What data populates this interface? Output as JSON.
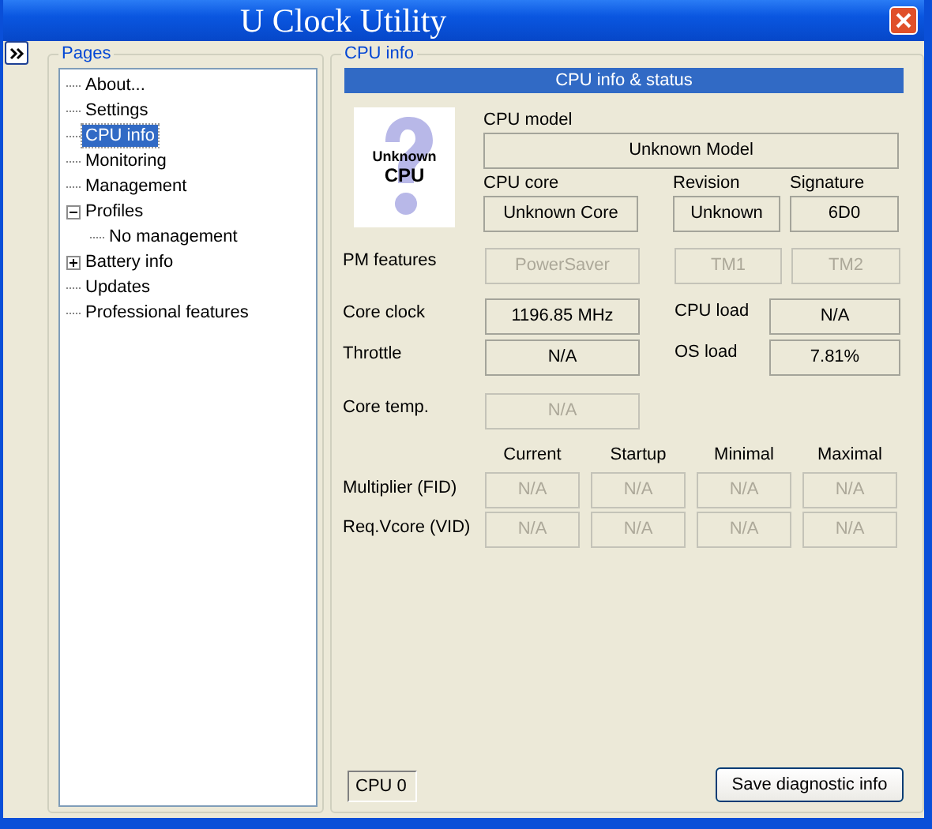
{
  "window": {
    "title": "U Clock Utility"
  },
  "pages": {
    "title": "Pages",
    "items": [
      {
        "label": "About...",
        "selected": false
      },
      {
        "label": "Settings",
        "selected": false
      },
      {
        "label": "CPU info",
        "selected": true
      },
      {
        "label": "Monitoring",
        "selected": false
      },
      {
        "label": "Management",
        "selected": false
      },
      {
        "label": "Profiles",
        "selected": false,
        "expanded": true,
        "children": [
          {
            "label": "No management",
            "selected": false
          }
        ]
      },
      {
        "label": "Battery info",
        "selected": false,
        "expanded": false
      },
      {
        "label": "Updates",
        "selected": false
      },
      {
        "label": "Professional features",
        "selected": false
      }
    ]
  },
  "cpu_info": {
    "title": "CPU info",
    "header": "CPU info & status",
    "image": {
      "line_1": "Unknown",
      "line_2": "CPU"
    },
    "model": {
      "label": "CPU model",
      "value": "Unknown Model"
    },
    "identity": [
      {
        "label": "CPU core",
        "value": "Unknown Core",
        "disabled": false
      },
      {
        "label": "Revision",
        "value": "Unknown",
        "disabled": false
      },
      {
        "label": "Signature",
        "value": "6D0",
        "disabled": false
      }
    ],
    "pm_features": {
      "label": "PM features",
      "values": [
        {
          "value": "PowerSaver",
          "disabled": true
        },
        {
          "value": "TM1",
          "disabled": true
        },
        {
          "value": "TM2",
          "disabled": true
        }
      ]
    },
    "readings": [
      {
        "label": "Core clock",
        "value": "1196.85 MHz",
        "disabled": false,
        "side": {
          "label": "CPU load",
          "value": "N/A",
          "disabled": false
        }
      },
      {
        "label": "Throttle",
        "value": "N/A",
        "disabled": false,
        "side": {
          "label": "OS load",
          "value": "7.81%",
          "disabled": false
        }
      },
      {
        "label": "Core temp.",
        "value": "N/A",
        "disabled": true
      }
    ],
    "ratios": {
      "columns": [
        "Current",
        "Startup",
        "Minimal",
        "Maximal"
      ],
      "rows": [
        {
          "label": "Multiplier (FID)",
          "cells": [
            {
              "value": "N/A",
              "disabled": true
            },
            {
              "value": "N/A",
              "disabled": true
            },
            {
              "value": "N/A",
              "disabled": true
            },
            {
              "value": "N/A",
              "disabled": true
            }
          ]
        },
        {
          "label": "Req.Vcore (VID)",
          "cells": [
            {
              "value": "N/A",
              "disabled": true
            },
            {
              "value": "N/A",
              "disabled": true
            },
            {
              "value": "N/A",
              "disabled": true
            },
            {
              "value": "N/A",
              "disabled": true
            }
          ]
        }
      ]
    },
    "cpu_selector": "CPU 0",
    "save_button": "Save diagnostic info"
  }
}
